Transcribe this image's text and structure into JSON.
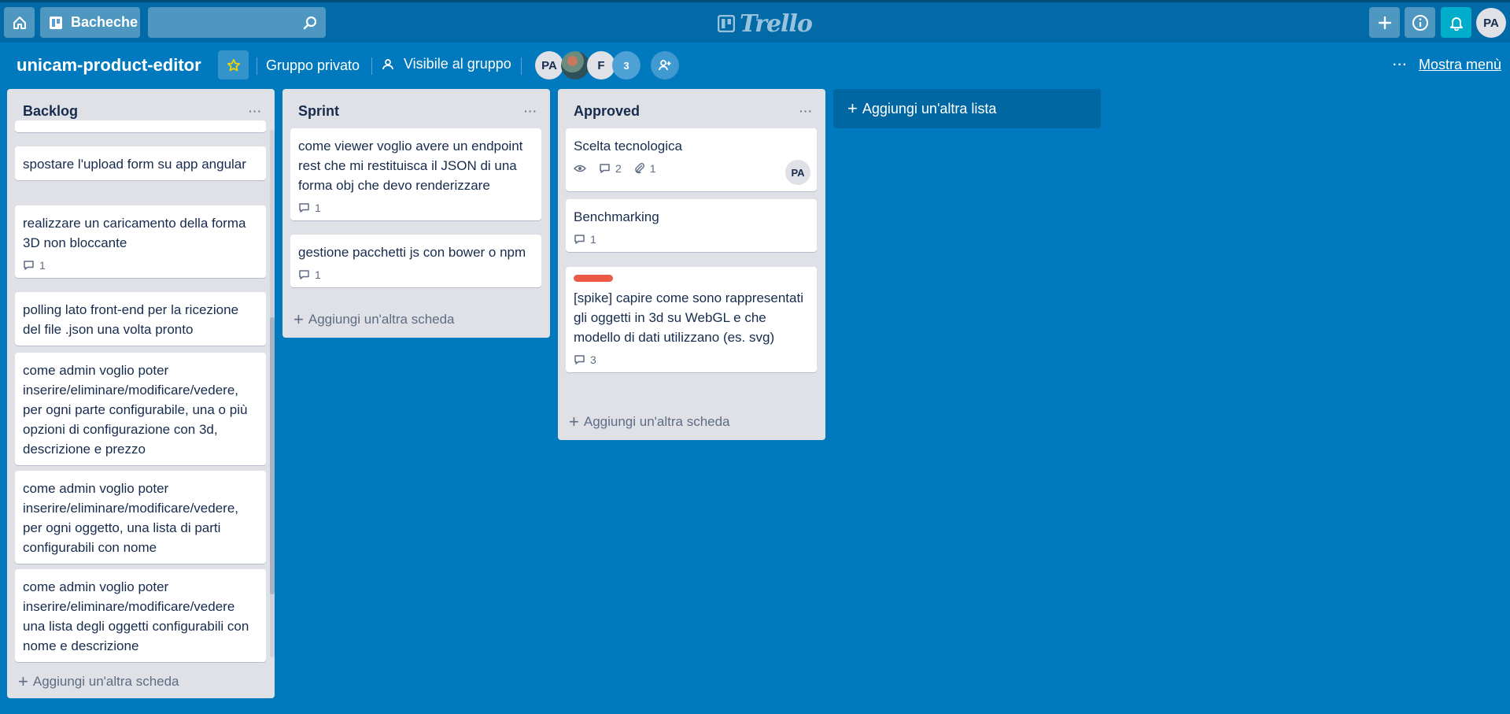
{
  "topbar": {
    "boards_label": "Bacheche",
    "search_placeholder": "",
    "logo_text": "Trello",
    "avatar_initials": "PA",
    "bell_color": "#00aecc"
  },
  "board": {
    "title": "unicam-product-editor",
    "team": "Gruppo privato",
    "visibility": "Visibile al gruppo",
    "members": [
      "PA",
      "F"
    ],
    "extra_members_count": "3",
    "menu_label": "Mostra menù",
    "menu_dots": "···",
    "background_color": "#0079bf"
  },
  "lists": {
    "backlog": {
      "title": "Backlog",
      "menu": "···",
      "cards": [
        {
          "title": "spostare l'upload form su app angular"
        },
        {
          "title": "realizzare un caricamento della forma 3D non bloccante",
          "comments": "1"
        },
        {
          "title": "polling lato front-end per la ricezione del file .json una volta pronto"
        },
        {
          "title": "come admin voglio poter inserire/eliminare/modificare/vedere, per ogni parte configurabile, una o più opzioni di configurazione con 3d, descrizione e prezzo"
        },
        {
          "title": "come admin voglio poter inserire/eliminare/modificare/vedere, per ogni oggetto, una lista di parti configurabili con nome"
        },
        {
          "title": "come admin voglio poter inserire/eliminare/modificare/vedere una lista degli oggetti configurabili con nome e descrizione"
        }
      ],
      "add_card": "Aggiungi un'altra scheda"
    },
    "sprint": {
      "title": "Sprint",
      "menu": "···",
      "cards": [
        {
          "title": "come viewer voglio avere un endpoint rest che mi restituisca il JSON di una forma obj che devo renderizzare",
          "comments": "1"
        },
        {
          "title": "gestione pacchetti js con bower o npm",
          "comments": "1"
        }
      ],
      "add_card": "Aggiungi un'altra scheda"
    },
    "approved": {
      "title": "Approved",
      "menu": "···",
      "cards": [
        {
          "title": "Scelta tecnologica",
          "comments": "2",
          "attachments": "1",
          "member": "PA"
        },
        {
          "title": "Benchmarking",
          "comments": "1"
        },
        {
          "title": "[spike] capire come sono rappresentati gli oggetti in 3d su WebGL e che modello di dati utilizzano (es. svg)",
          "comments": "3",
          "label_color": "#eb5a46"
        }
      ],
      "add_card": "Aggiungi un'altra scheda"
    }
  },
  "add_list": "Aggiungi un'altra lista"
}
